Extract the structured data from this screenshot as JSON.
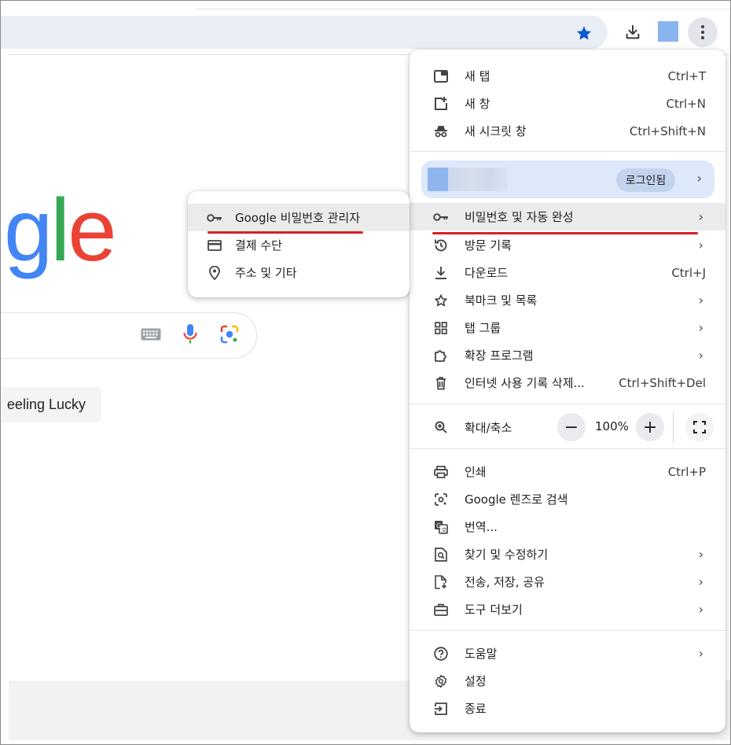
{
  "menu": {
    "items_top": [
      {
        "label": "새 탭",
        "shortcut": "Ctrl+T",
        "icon": "new-tab-icon"
      },
      {
        "label": "새 창",
        "shortcut": "Ctrl+N",
        "icon": "new-window-icon"
      },
      {
        "label": "새 시크릿 창",
        "shortcut": "Ctrl+Shift+N",
        "icon": "incognito-icon"
      }
    ],
    "profile": {
      "login_label": "로그인됨"
    },
    "items_mid": [
      {
        "label": "비밀번호 및 자동 완성",
        "icon": "key-icon",
        "has_submenu": true,
        "highlighted": true
      },
      {
        "label": "방문 기록",
        "icon": "history-icon",
        "has_submenu": true
      },
      {
        "label": "다운로드",
        "shortcut": "Ctrl+J",
        "icon": "download-icon"
      },
      {
        "label": "북마크 및 목록",
        "icon": "star-outline-icon",
        "has_submenu": true
      },
      {
        "label": "탭 그룹",
        "icon": "tab-groups-icon",
        "has_submenu": true
      },
      {
        "label": "확장 프로그램",
        "icon": "extension-icon",
        "has_submenu": true
      },
      {
        "label": "인터넷 사용 기록 삭제...",
        "shortcut": "Ctrl+Shift+Del",
        "icon": "trash-icon"
      }
    ],
    "zoom": {
      "label": "확대/축소",
      "value": "100%",
      "minus": "−",
      "plus": "+"
    },
    "items_bottom": [
      {
        "label": "인쇄",
        "shortcut": "Ctrl+P",
        "icon": "print-icon"
      },
      {
        "label": "Google 렌즈로 검색",
        "icon": "lens-icon"
      },
      {
        "label": "번역...",
        "icon": "translate-icon"
      },
      {
        "label": "찾기 및 수정하기",
        "icon": "find-icon",
        "has_submenu": true
      },
      {
        "label": "전송, 저장, 공유",
        "icon": "share-icon",
        "has_submenu": true
      },
      {
        "label": "도구 더보기",
        "icon": "toolbox-icon",
        "has_submenu": true
      }
    ],
    "items_end": [
      {
        "label": "도움말",
        "icon": "help-icon",
        "has_submenu": true
      },
      {
        "label": "설정",
        "icon": "settings-icon"
      },
      {
        "label": "종료",
        "icon": "exit-icon"
      }
    ]
  },
  "submenu": {
    "items": [
      {
        "label": "Google 비밀번호 관리자",
        "icon": "key-icon"
      },
      {
        "label": "결제 수단",
        "icon": "credit-card-icon"
      },
      {
        "label": "주소 및 기타",
        "icon": "location-pin-icon"
      }
    ]
  },
  "page": {
    "logo_letters": [
      "g",
      "l",
      "e"
    ],
    "lucky_button": "eeling Lucky"
  },
  "colors": {
    "accent_red": "#d91f26",
    "star_blue": "#0b57d0",
    "omnibox": "#e9eef6",
    "profile_bg": "#dde8fb",
    "logo_blue": "#4285f4",
    "logo_green": "#34a853",
    "logo_red": "#ea4335"
  }
}
